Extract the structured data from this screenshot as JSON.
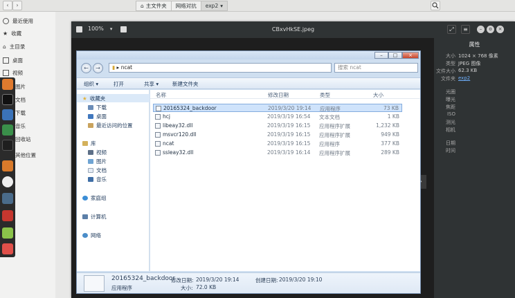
{
  "files_header": {
    "crumbs": [
      {
        "icon": "home-icon",
        "label": "主文件夹"
      },
      {
        "icon": "",
        "label": "网络对抗"
      },
      {
        "icon": "",
        "label": "exp2"
      }
    ]
  },
  "sidebar": {
    "items": [
      {
        "icon": "clock-icon",
        "label": "最近使用"
      },
      {
        "icon": "star-icon",
        "label": "收藏"
      },
      {
        "icon": "home-icon",
        "label": "主目录"
      },
      {
        "icon": "desktop-icon",
        "label": "桌面"
      },
      {
        "icon": "video-icon",
        "label": "视频"
      },
      {
        "icon": "picture-icon",
        "label": "图片"
      },
      {
        "icon": "document-icon",
        "label": "文档"
      },
      {
        "icon": "download-icon",
        "label": "下载"
      },
      {
        "icon": "music-icon",
        "label": "音乐"
      },
      {
        "icon": "trash-icon",
        "label": "回收站"
      },
      {
        "icon": "plus-icon",
        "label": "其他位置"
      }
    ]
  },
  "viewer": {
    "zoom": "100%",
    "title": "CBxvHkSE.jpeg",
    "props": {
      "header": "属性",
      "rows": [
        {
          "key": "大小",
          "value": "1024 × 768 像素"
        },
        {
          "key": "类型",
          "value": "JPEG 图像"
        },
        {
          "key": "文件大小",
          "value": "62.3 KB"
        },
        {
          "key": "文件夹",
          "value": "exp2"
        },
        {
          "key": "光圈",
          "value": ""
        },
        {
          "key": "曝光",
          "value": ""
        },
        {
          "key": "焦距",
          "value": ""
        },
        {
          "key": "ISO",
          "value": ""
        },
        {
          "key": "测光",
          "value": ""
        },
        {
          "key": "相机",
          "value": ""
        },
        {
          "key": "日期",
          "value": ""
        },
        {
          "key": "时间",
          "value": ""
        }
      ]
    }
  },
  "explorer": {
    "address": "ncat",
    "search_placeholder": "搜索 ncat",
    "toolbar": {
      "organize": "组织 ▾",
      "open": "打开",
      "share": "共享 ▾",
      "new_folder": "新建文件夹"
    },
    "nav": {
      "favorites": "收藏夹",
      "downloads": "下载",
      "desktop": "桌面",
      "recent": "最近访问的位置",
      "libraries": "库",
      "videos": "视频",
      "pictures": "图片",
      "documents": "文档",
      "music": "音乐",
      "homegroup": "家庭组",
      "computer": "计算机",
      "network": "网络"
    },
    "columns": {
      "name": "名称",
      "modified": "修改日期",
      "type": "类型",
      "size": "大小"
    },
    "files": [
      {
        "name": "20165324_backdoor",
        "modified": "2019/3/20 19:14",
        "type": "应用程序",
        "size": "73 KB"
      },
      {
        "name": "hcj",
        "modified": "2019/3/19 16:54",
        "type": "文本文档",
        "size": "1 KB"
      },
      {
        "name": "libeay32.dll",
        "modified": "2019/3/19 16:15",
        "type": "应用程序扩展",
        "size": "1,232 KB"
      },
      {
        "name": "msvcr120.dll",
        "modified": "2019/3/19 16:15",
        "type": "应用程序扩展",
        "size": "949 KB"
      },
      {
        "name": "ncat",
        "modified": "2019/3/19 16:15",
        "type": "应用程序",
        "size": "377 KB"
      },
      {
        "name": "ssleay32.dll",
        "modified": "2019/3/19 16:14",
        "type": "应用程序扩展",
        "size": "289 KB"
      }
    ],
    "details": {
      "name": "20165324_backdoor",
      "modified_label": "修改日期:",
      "modified": "2019/3/20 19:14",
      "created_label": "创建日期:",
      "created": "2019/3/20 19:10",
      "type": "应用程序",
      "size_label": "大小:",
      "size": "72.0 KB"
    }
  }
}
